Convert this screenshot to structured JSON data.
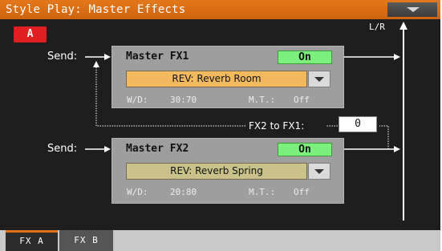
{
  "header": {
    "title": "Style Play: Master Effects"
  },
  "section_button": {
    "label": "A"
  },
  "output": {
    "label": "L/R"
  },
  "fx1": {
    "send_label": "Send:",
    "title": "Master FX1",
    "on_label": "On",
    "preset": "REV: Reverb Room",
    "wd_label": "W/D:",
    "wd_value": "30:70",
    "mt_label": "M.T.:",
    "mt_value": "Off"
  },
  "fx2_to_fx1": {
    "label": "FX2 to FX1:",
    "value": "0"
  },
  "fx2": {
    "send_label": "Send:",
    "title": "Master FX2",
    "on_label": "On",
    "preset": "REV: Reverb Spring",
    "wd_label": "W/D:",
    "wd_value": "20:80",
    "mt_label": "M.T.:",
    "mt_value": "Off"
  },
  "tabs": [
    {
      "label": "FX A",
      "active": true
    },
    {
      "label": "FX B",
      "active": false
    }
  ],
  "colors": {
    "title_bar": "#d96d14",
    "on_button": "#7cf07c",
    "fx1_preset": "#f2b95e",
    "fx2_preset": "#c9c28a",
    "section_button": "#e02020"
  }
}
